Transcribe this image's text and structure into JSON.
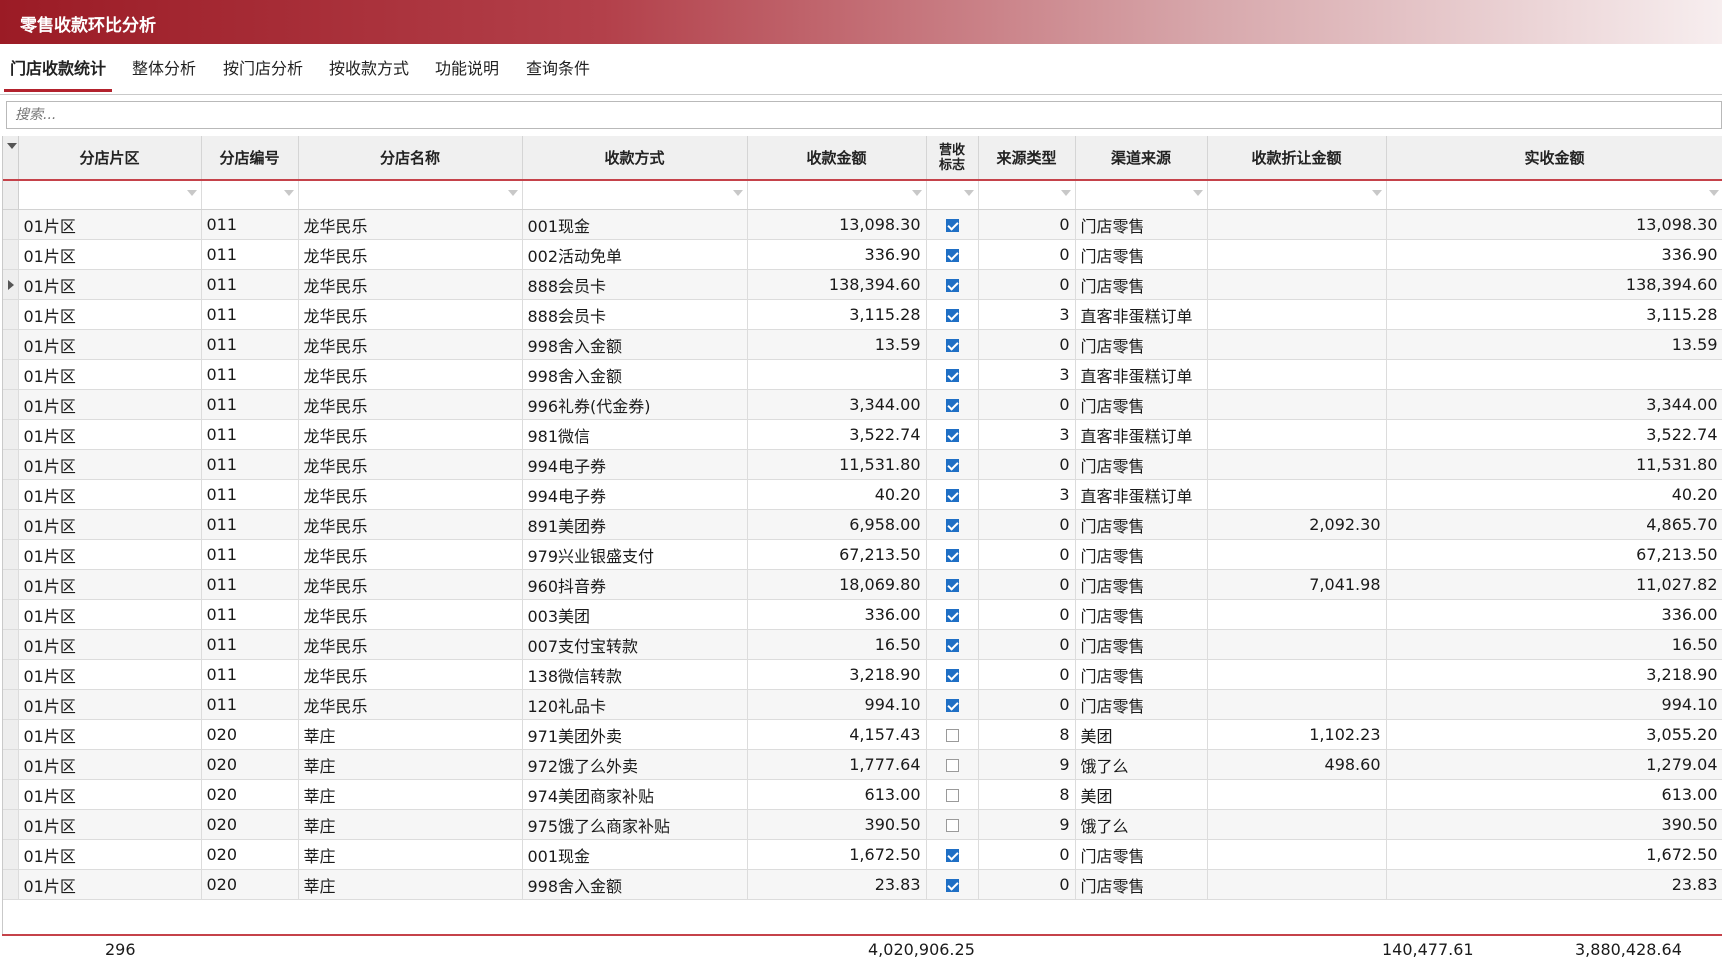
{
  "window": {
    "title": "零售收款环比分析"
  },
  "tabs": [
    "门店收款统计",
    "整体分析",
    "按门店分析",
    "按收款方式",
    "功能说明",
    "查询条件"
  ],
  "search": {
    "placeholder": "搜索..."
  },
  "columns": [
    "分店片区",
    "分店编号",
    "分店名称",
    "收款方式",
    "收款金额",
    "营收标志",
    "来源类型",
    "渠道来源",
    "收款折让金额",
    "实收金额"
  ],
  "rows": [
    {
      "area": "01片区",
      "code": "011",
      "name": "龙华民乐",
      "method": "001现金",
      "amount": "13,098.30",
      "flag": true,
      "src": "0",
      "channel": "门店零售",
      "discount": "",
      "actual": "13,098.30"
    },
    {
      "area": "01片区",
      "code": "011",
      "name": "龙华民乐",
      "method": "002活动免单",
      "amount": "336.90",
      "flag": true,
      "src": "0",
      "channel": "门店零售",
      "discount": "",
      "actual": "336.90"
    },
    {
      "area": "01片区",
      "code": "011",
      "name": "龙华民乐",
      "method": "888会员卡",
      "amount": "138,394.60",
      "flag": true,
      "src": "0",
      "channel": "门店零售",
      "discount": "",
      "actual": "138,394.60",
      "current": true
    },
    {
      "area": "01片区",
      "code": "011",
      "name": "龙华民乐",
      "method": "888会员卡",
      "amount": "3,115.28",
      "flag": true,
      "src": "3",
      "channel": "直客非蛋糕订单",
      "discount": "",
      "actual": "3,115.28"
    },
    {
      "area": "01片区",
      "code": "011",
      "name": "龙华民乐",
      "method": "998舍入金额",
      "amount": "13.59",
      "flag": true,
      "src": "0",
      "channel": "门店零售",
      "discount": "",
      "actual": "13.59"
    },
    {
      "area": "01片区",
      "code": "011",
      "name": "龙华民乐",
      "method": "998舍入金额",
      "amount": "",
      "flag": true,
      "src": "3",
      "channel": "直客非蛋糕订单",
      "discount": "",
      "actual": ""
    },
    {
      "area": "01片区",
      "code": "011",
      "name": "龙华民乐",
      "method": "996礼券(代金券)",
      "amount": "3,344.00",
      "flag": true,
      "src": "0",
      "channel": "门店零售",
      "discount": "",
      "actual": "3,344.00"
    },
    {
      "area": "01片区",
      "code": "011",
      "name": "龙华民乐",
      "method": "981微信",
      "amount": "3,522.74",
      "flag": true,
      "src": "3",
      "channel": "直客非蛋糕订单",
      "discount": "",
      "actual": "3,522.74"
    },
    {
      "area": "01片区",
      "code": "011",
      "name": "龙华民乐",
      "method": "994电子券",
      "amount": "11,531.80",
      "flag": true,
      "src": "0",
      "channel": "门店零售",
      "discount": "",
      "actual": "11,531.80"
    },
    {
      "area": "01片区",
      "code": "011",
      "name": "龙华民乐",
      "method": "994电子券",
      "amount": "40.20",
      "flag": true,
      "src": "3",
      "channel": "直客非蛋糕订单",
      "discount": "",
      "actual": "40.20"
    },
    {
      "area": "01片区",
      "code": "011",
      "name": "龙华民乐",
      "method": "891美团券",
      "amount": "6,958.00",
      "flag": true,
      "src": "0",
      "channel": "门店零售",
      "discount": "2,092.30",
      "actual": "4,865.70"
    },
    {
      "area": "01片区",
      "code": "011",
      "name": "龙华民乐",
      "method": "979兴业银盛支付",
      "amount": "67,213.50",
      "flag": true,
      "src": "0",
      "channel": "门店零售",
      "discount": "",
      "actual": "67,213.50"
    },
    {
      "area": "01片区",
      "code": "011",
      "name": "龙华民乐",
      "method": "960抖音券",
      "amount": "18,069.80",
      "flag": true,
      "src": "0",
      "channel": "门店零售",
      "discount": "7,041.98",
      "actual": "11,027.82"
    },
    {
      "area": "01片区",
      "code": "011",
      "name": "龙华民乐",
      "method": "003美团",
      "amount": "336.00",
      "flag": true,
      "src": "0",
      "channel": "门店零售",
      "discount": "",
      "actual": "336.00"
    },
    {
      "area": "01片区",
      "code": "011",
      "name": "龙华民乐",
      "method": "007支付宝转款",
      "amount": "16.50",
      "flag": true,
      "src": "0",
      "channel": "门店零售",
      "discount": "",
      "actual": "16.50"
    },
    {
      "area": "01片区",
      "code": "011",
      "name": "龙华民乐",
      "method": "138微信转款",
      "amount": "3,218.90",
      "flag": true,
      "src": "0",
      "channel": "门店零售",
      "discount": "",
      "actual": "3,218.90"
    },
    {
      "area": "01片区",
      "code": "011",
      "name": "龙华民乐",
      "method": "120礼品卡",
      "amount": "994.10",
      "flag": true,
      "src": "0",
      "channel": "门店零售",
      "discount": "",
      "actual": "994.10"
    },
    {
      "area": "01片区",
      "code": "020",
      "name": "莘庄",
      "method": "971美团外卖",
      "amount": "4,157.43",
      "flag": false,
      "src": "8",
      "channel": "美团",
      "discount": "1,102.23",
      "actual": "3,055.20"
    },
    {
      "area": "01片区",
      "code": "020",
      "name": "莘庄",
      "method": "972饿了么外卖",
      "amount": "1,777.64",
      "flag": false,
      "src": "9",
      "channel": "饿了么",
      "discount": "498.60",
      "actual": "1,279.04"
    },
    {
      "area": "01片区",
      "code": "020",
      "name": "莘庄",
      "method": "974美团商家补贴",
      "amount": "613.00",
      "flag": false,
      "src": "8",
      "channel": "美团",
      "discount": "",
      "actual": "613.00"
    },
    {
      "area": "01片区",
      "code": "020",
      "name": "莘庄",
      "method": "975饿了么商家补贴",
      "amount": "390.50",
      "flag": false,
      "src": "9",
      "channel": "饿了么",
      "discount": "",
      "actual": "390.50"
    },
    {
      "area": "01片区",
      "code": "020",
      "name": "莘庄",
      "method": "001现金",
      "amount": "1,672.50",
      "flag": true,
      "src": "0",
      "channel": "门店零售",
      "discount": "",
      "actual": "1,672.50"
    },
    {
      "area": "01片区",
      "code": "020",
      "name": "莘庄",
      "method": "998舍入金额",
      "amount": "23.83",
      "flag": true,
      "src": "0",
      "channel": "门店零售",
      "discount": "",
      "actual": "23.83"
    }
  ],
  "footer": {
    "count": "296",
    "amount_total": "4,020,906.25",
    "discount_total": "140,477.61",
    "actual_total": "3,880,428.64"
  }
}
